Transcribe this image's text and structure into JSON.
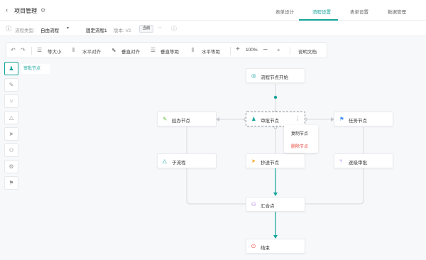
{
  "header": {
    "title": "项目管理",
    "tabs": [
      {
        "label": "表单设计"
      },
      {
        "label": "流程设置"
      },
      {
        "label": "表单设置"
      },
      {
        "label": "数据管理"
      }
    ]
  },
  "flowbar": {
    "type_label": "流程类型:",
    "type_value": "自由流程",
    "fixed_label": "固定流程1",
    "version_label": "版本: V2",
    "badge": "当前"
  },
  "toolbar": {
    "equal_size": "等大小",
    "h_align": "水平对齐",
    "v_align": "垂直对齐",
    "v_spacing": "垂直等距",
    "h_spacing": "水平等距",
    "zoom": "100%",
    "docs": "说明文档"
  },
  "sidebar": {
    "tooltip": "审批节点",
    "items": [
      {
        "icon": "user-icon"
      },
      {
        "icon": "pencil-icon"
      },
      {
        "icon": "branch-icon"
      },
      {
        "icon": "triangle-icon"
      },
      {
        "icon": "send-icon"
      },
      {
        "icon": "merge-icon"
      },
      {
        "icon": "gear-icon"
      },
      {
        "icon": "flag-icon"
      }
    ]
  },
  "nodes": {
    "start": "流程节点开始",
    "handle": "经办节点",
    "approve": "审批节点",
    "task": "任务节点",
    "subflow": "子流程",
    "cc": "抄送节点",
    "sequential": "逐级审批",
    "merge": "汇合点",
    "end": "结束"
  },
  "context_menu": {
    "copy": "复制节点",
    "delete": "删除节点"
  },
  "colors": {
    "accent": "#14a39a",
    "danger": "#e8473f",
    "handle": "#6cc24a",
    "task": "#3d8bf2",
    "cc": "#f5a623",
    "merge": "#9b5de5"
  }
}
